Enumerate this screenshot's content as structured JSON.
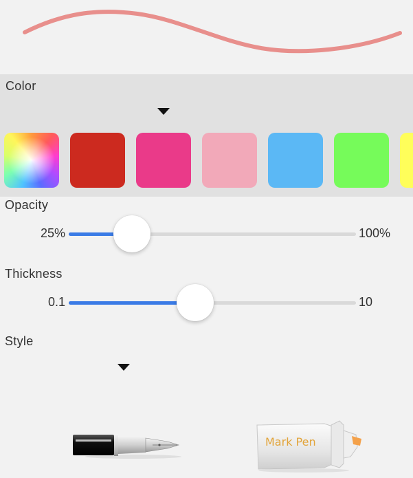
{
  "preview": {
    "stroke_color": "#e88f8c"
  },
  "color": {
    "label": "Color",
    "swatches": [
      {
        "name": "color-wheel",
        "color": "multicolor"
      },
      {
        "name": "red",
        "color": "#cc2a1f"
      },
      {
        "name": "magenta",
        "color": "#ea3a89"
      },
      {
        "name": "pink",
        "color": "#f2a9b9"
      },
      {
        "name": "sky-blue",
        "color": "#5bb8f5"
      },
      {
        "name": "green",
        "color": "#76fb5a"
      },
      {
        "name": "yellow",
        "color": "#fffe5a"
      }
    ]
  },
  "opacity": {
    "label": "Opacity",
    "min_label": "25%",
    "max_label": "100%",
    "value_fraction": 0.22
  },
  "thickness": {
    "label": "Thickness",
    "min_label": "0.1",
    "max_label": "10",
    "value_fraction": 0.44
  },
  "style": {
    "label": "Style",
    "options": [
      {
        "name": "fountain-pen",
        "label": ""
      },
      {
        "name": "mark-pen",
        "label": "Mark Pen"
      }
    ]
  },
  "accent_color": "#3a7be6"
}
